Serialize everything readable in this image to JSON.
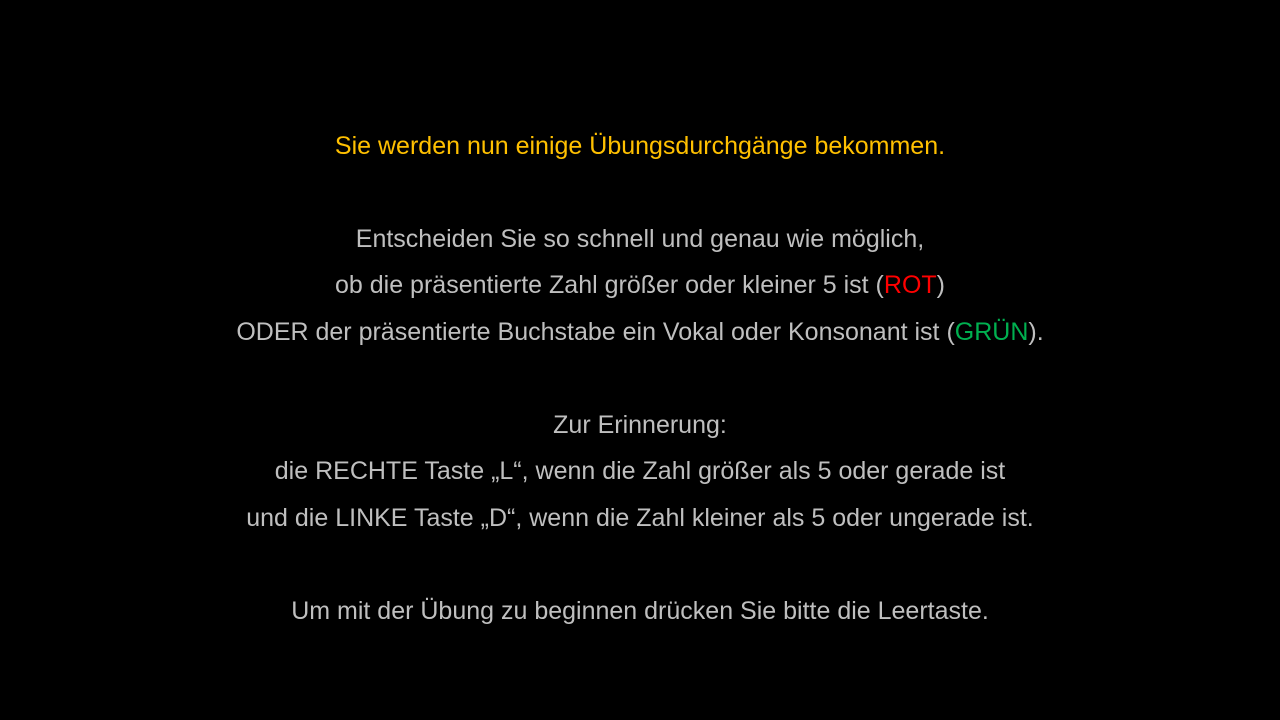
{
  "colors": {
    "background": "#000000",
    "text": "#bfbfbf",
    "heading": "#ffc000",
    "red": "#ff0000",
    "green": "#00b050"
  },
  "heading": "Sie werden nun einige Übungsdurchgänge bekommen.",
  "task": {
    "line1": "Entscheiden Sie so schnell und genau wie möglich,",
    "line2_prefix": "ob die präsentierte Zahl größer oder kleiner 5 ist (",
    "line2_red": "ROT",
    "line2_suffix": ")",
    "line3_prefix": "ODER der präsentierte Buchstabe ein Vokal oder Konsonant ist (",
    "line3_green": "GRÜN",
    "line3_suffix": ")."
  },
  "reminder": {
    "title": "Zur Erinnerung:",
    "right_key": "die RECHTE Taste „L“, wenn die Zahl größer als 5 oder gerade ist",
    "left_key": "und die LINKE Taste „D“, wenn die Zahl kleiner als 5 oder ungerade ist."
  },
  "start_prompt": "Um mit der Übung zu beginnen drücken Sie bitte die Leertaste."
}
